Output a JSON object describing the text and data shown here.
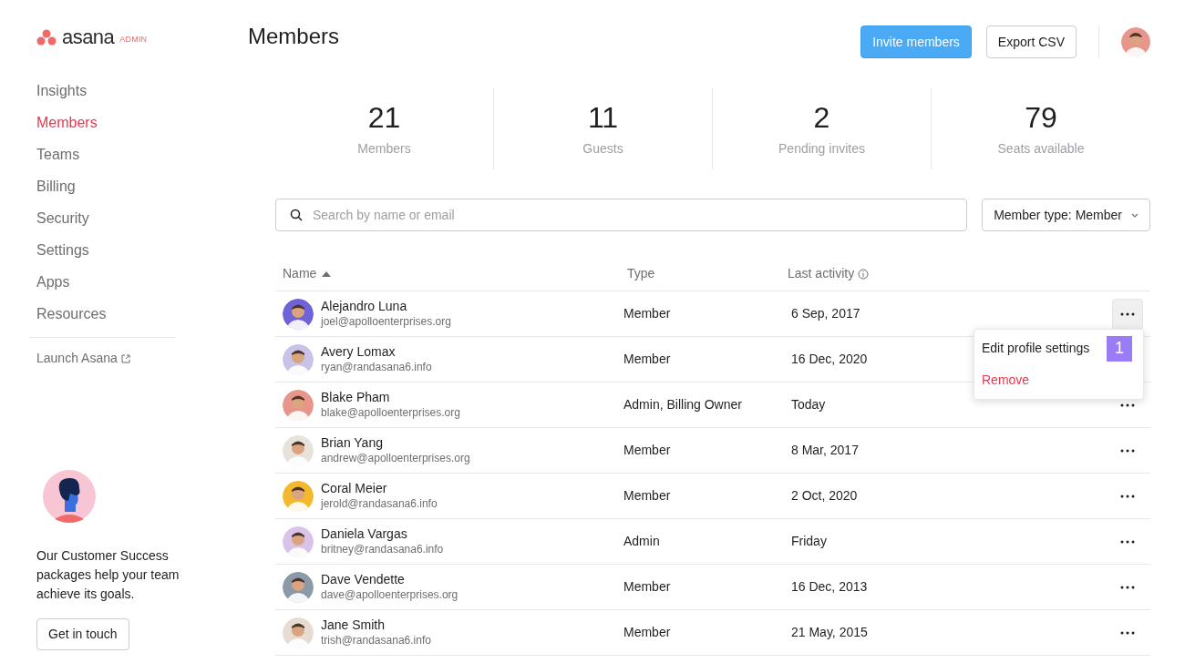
{
  "brand": {
    "name": "asana",
    "badge": "ADMIN"
  },
  "sidebar": {
    "items": [
      {
        "label": "Insights",
        "selected": false
      },
      {
        "label": "Members",
        "selected": true
      },
      {
        "label": "Teams",
        "selected": false
      },
      {
        "label": "Billing",
        "selected": false
      },
      {
        "label": "Security",
        "selected": false
      },
      {
        "label": "Settings",
        "selected": false
      },
      {
        "label": "Apps",
        "selected": false
      },
      {
        "label": "Resources",
        "selected": false
      }
    ],
    "launch": "Launch Asana",
    "promo": {
      "text": "Our Customer Success packages help your team achieve its goals.",
      "button": "Get in touch"
    }
  },
  "header": {
    "title": "Members",
    "buttons": [
      {
        "label": "Invite members",
        "kind": "primary"
      },
      {
        "label": "Export CSV",
        "kind": "secondary"
      }
    ]
  },
  "stats": [
    {
      "value": "21",
      "label": "Members"
    },
    {
      "value": "11",
      "label": "Guests"
    },
    {
      "value": "2",
      "label": "Pending invites"
    },
    {
      "value": "79",
      "label": "Seats available"
    }
  ],
  "search": {
    "placeholder": "Search by name or email"
  },
  "filter": {
    "label": "Member type: Member"
  },
  "table": {
    "columns": [
      "Name",
      "Type",
      "Last activity"
    ],
    "rows": [
      {
        "name": "Alejandro Luna",
        "email": "joel@apolloenterprises.org",
        "type": "Member",
        "last_activity": "6 Sep, 2017",
        "color": "#6f63d9",
        "menu_open": true
      },
      {
        "name": "Avery Lomax",
        "email": "ryan@randasana6.info",
        "type": "Member",
        "last_activity": "16 Dec, 2020",
        "color": "#c9c3e8",
        "menu_open": false
      },
      {
        "name": "Blake Pham",
        "email": "blake@apolloenterprises.org",
        "type": "Admin, Billing Owner",
        "last_activity": "Today",
        "color": "#e8958c",
        "menu_open": false
      },
      {
        "name": "Brian Yang",
        "email": "andrew@apolloenterprises.org",
        "type": "Member",
        "last_activity": "8 Mar, 2017",
        "color": "#e8e2dc",
        "menu_open": false
      },
      {
        "name": "Coral Meier",
        "email": "jerold@randasana6.info",
        "type": "Member",
        "last_activity": "2 Oct, 2020",
        "color": "#f2b92e",
        "menu_open": false
      },
      {
        "name": "Daniela Vargas",
        "email": "britney@randasana6.info",
        "type": "Admin",
        "last_activity": "Friday",
        "color": "#d9c3e8",
        "menu_open": false
      },
      {
        "name": "Dave Vendette",
        "email": "dave@apolloenterprises.org",
        "type": "Member",
        "last_activity": "16 Dec, 2013",
        "color": "#8a9aa8",
        "menu_open": false
      },
      {
        "name": "Jane Smith",
        "email": "trish@randasana6.info",
        "type": "Member",
        "last_activity": "21 May, 2015",
        "color": "#e6dcd2",
        "menu_open": false
      }
    ]
  },
  "menu": {
    "items": [
      {
        "label": "Edit profile settings",
        "kind": "normal",
        "marker": "1"
      },
      {
        "label": "Remove",
        "kind": "danger"
      }
    ]
  }
}
